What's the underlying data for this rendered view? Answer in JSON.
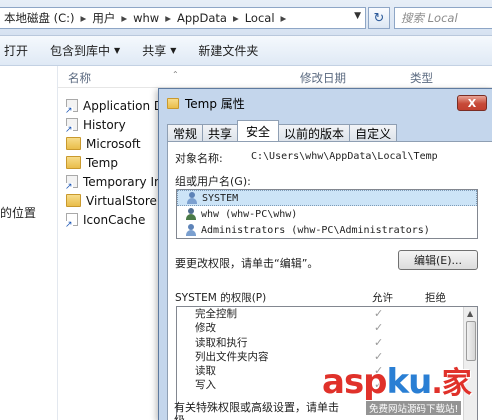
{
  "address_bar": {
    "path": [
      "本地磁盘 (C:)",
      "用户",
      "whw",
      "AppData",
      "Local"
    ],
    "search_placeholder": "搜索 Local"
  },
  "toolbar": {
    "open": "打开",
    "include_in_library": "包含到库中",
    "share": "共享",
    "new_folder": "新建文件夹"
  },
  "nav_pane": {
    "partial_item": "的位置"
  },
  "columns": {
    "name": "名称",
    "modified": "修改日期",
    "type": "类型"
  },
  "files": [
    {
      "name": "Application D",
      "icon": "folder-link-icon"
    },
    {
      "name": "History",
      "icon": "folder-link-icon"
    },
    {
      "name": "Microsoft",
      "icon": "folder-icon"
    },
    {
      "name": "Temp",
      "icon": "folder-icon"
    },
    {
      "name": "Temporary In",
      "icon": "folder-link-icon"
    },
    {
      "name": "VirtualStore",
      "icon": "folder-icon"
    },
    {
      "name": "IconCache",
      "icon": "file-icon"
    }
  ],
  "dialog": {
    "title": "Temp 属性",
    "close_label": "X",
    "tabs": [
      "常规",
      "共享",
      "安全",
      "以前的版本",
      "自定义"
    ],
    "active_tab": "安全",
    "object_label": "对象名称:",
    "object_value": "C:\\Users\\whw\\AppData\\Local\\Temp",
    "group_label": "组或用户名(G):",
    "users": [
      "SYSTEM",
      "whw (whw-PC\\whw)",
      "Administrators (whw-PC\\Administrators)"
    ],
    "selected_user": "SYSTEM",
    "change_text": "要更改权限，请单击“编辑”。",
    "edit_button": "编辑(E)...",
    "perm_title": "SYSTEM 的权限(P)",
    "allow_label": "允许",
    "deny_label": "拒绝",
    "permissions": [
      {
        "name": "完全控制",
        "allow": "✓"
      },
      {
        "name": "修改",
        "allow": "✓"
      },
      {
        "name": "读取和执行",
        "allow": "✓"
      },
      {
        "name": "列出文件夹内容",
        "allow": "✓"
      },
      {
        "name": "读取",
        "allow": "✓"
      },
      {
        "name": "写入",
        "allow": "✓"
      }
    ],
    "special_text_line1": "有关特殊权限或高级设置，请单击",
    "special_text_line2": "级"
  },
  "watermark": {
    "asp": "asp",
    "ku": "ku",
    "suffix": ".家",
    "sub": "免费网站源码下载站!"
  },
  "colors": {
    "dialog_frame": "#c4d6ec",
    "selection": "#cce4f7",
    "close_button": "#c74a38",
    "watermark_red": "#e0312a",
    "watermark_blue": "#2a7fd4"
  }
}
